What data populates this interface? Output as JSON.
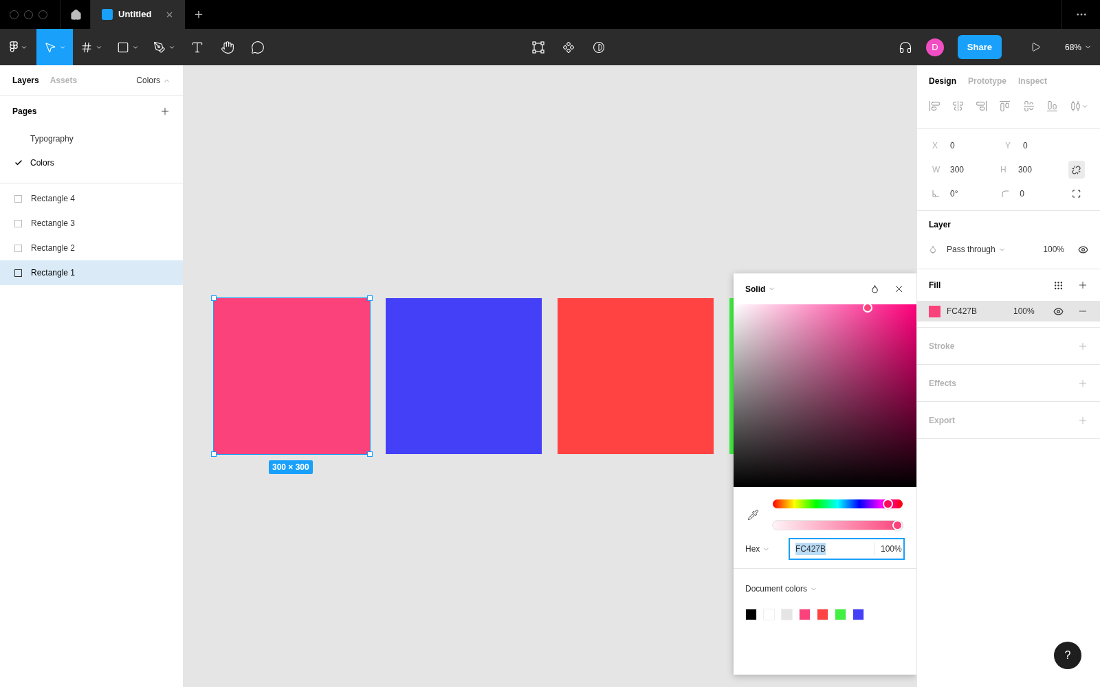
{
  "window": {
    "tabs": [
      {
        "title": "Untitled",
        "selected": true
      }
    ]
  },
  "toolbar": {
    "tools": [
      {
        "kind": "menu",
        "selected": false
      },
      {
        "kind": "move",
        "selected": true
      },
      {
        "kind": "frame",
        "selected": false
      },
      {
        "kind": "shape",
        "selected": false
      },
      {
        "kind": "pen",
        "selected": false
      },
      {
        "kind": "text",
        "selected": false
      },
      {
        "kind": "hand",
        "selected": false
      },
      {
        "kind": "comment",
        "selected": false
      }
    ],
    "avatar": "D",
    "share": "Share",
    "zoom": "68%"
  },
  "left_panel": {
    "tabs": [
      {
        "label": "Layers",
        "selected": true
      },
      {
        "label": "Assets",
        "selected": false
      }
    ],
    "page_menu": "Colors",
    "pages_title": "Pages",
    "pages": [
      {
        "name": "Typography",
        "selected": false
      },
      {
        "name": "Colors",
        "selected": true
      }
    ],
    "layers": [
      {
        "name": "Rectangle 4",
        "selected": false
      },
      {
        "name": "Rectangle 3",
        "selected": false
      },
      {
        "name": "Rectangle 2",
        "selected": false
      },
      {
        "name": "Rectangle 1",
        "selected": true
      }
    ]
  },
  "canvas": {
    "rectangles": [
      {
        "color": "#fc427b",
        "selected": true
      },
      {
        "color": "#4440f8",
        "selected": false
      },
      {
        "color": "#ff4242",
        "selected": false
      },
      {
        "color": "#42f042",
        "selected": false
      }
    ],
    "size_label": "300 × 300"
  },
  "color_picker": {
    "mode": "Solid",
    "hue": {
      "level": 0.92
    },
    "alpha": {
      "level": 1
    },
    "format": "Hex",
    "hex": "FC427B",
    "opacity": "100%",
    "document_colors_title": "Document colors",
    "swatches": [
      {
        "color": "#000000"
      },
      {
        "color": "#ffffff"
      },
      {
        "color": "#e5e5e5"
      },
      {
        "color": "#fc427b"
      },
      {
        "color": "#ff4242"
      },
      {
        "color": "#42f042"
      },
      {
        "color": "#4440f8"
      }
    ]
  },
  "right_panel": {
    "tabs": [
      {
        "label": "Design",
        "selected": true
      },
      {
        "label": "Prototype",
        "selected": false
      },
      {
        "label": "Inspect",
        "selected": false
      }
    ],
    "fields": [
      {
        "kind": "label",
        "label": "X",
        "value": "0"
      },
      {
        "kind": "label",
        "label": "Y",
        "value": "0"
      },
      {
        "kind": "label",
        "label": "W",
        "value": "300"
      },
      {
        "kind": "label",
        "label": "H",
        "value": "300"
      },
      {
        "kind": "angle",
        "value": "0°"
      },
      {
        "kind": "radius",
        "value": "0"
      }
    ],
    "layer": {
      "title": "Layer",
      "blend": "Pass through",
      "opacity": "100%"
    },
    "fill": {
      "title": "Fill",
      "items": [
        {
          "hex": "FC427B",
          "opacity": "100%",
          "color": "#fc427b"
        }
      ]
    },
    "sections": [
      {
        "title": "Stroke"
      },
      {
        "title": "Effects"
      },
      {
        "title": "Export"
      }
    ]
  },
  "help": "?"
}
